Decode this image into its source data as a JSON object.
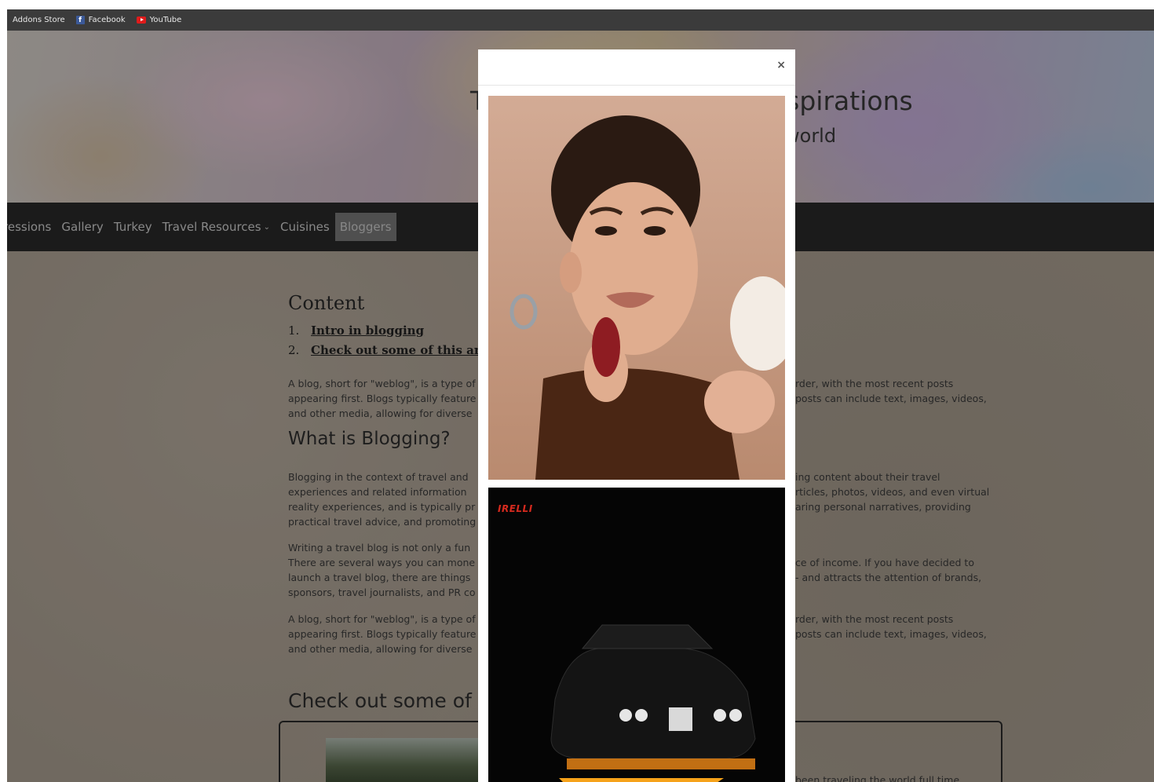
{
  "bookmarks": [
    {
      "label": "Addons Store"
    },
    {
      "label": "Facebook",
      "icon": "facebook-icon"
    },
    {
      "label": "YouTube",
      "icon": "youtube-icon"
    }
  ],
  "hero": {
    "title_partial_left": "T",
    "title_partial_right": "spirations",
    "subtitle_partial": "world"
  },
  "nav": {
    "items": [
      "ressions",
      "Gallery",
      "Turkey",
      "Travel Resources",
      "Cuisines"
    ],
    "active": "Bloggers"
  },
  "content": {
    "heading": "Content",
    "toc": [
      {
        "num": "1.",
        "label": "Intro in blogging"
      },
      {
        "num": "2.",
        "label": "Check out some of this ama:"
      }
    ],
    "p1_left": [
      "A blog, short for \"weblog\", is a type of",
      "appearing first. Blogs typically feature",
      "and other media, allowing for diverse"
    ],
    "p1_right": [
      "rder, with the most recent posts",
      "posts can include text, images, videos,"
    ],
    "h_blogging": "What is Blogging?",
    "p2_left": [
      "Blogging in the context of travel and",
      "experiences and related information",
      "reality experiences, and is typically pr",
      "practical travel advice, and promoting"
    ],
    "p2_right": [
      "ing content about their travel",
      "rticles, photos, videos, and even virtual",
      "aring personal narratives, providing"
    ],
    "p3_left": [
      "Writing a travel blog is not only a fun",
      "There are several ways you can mone",
      "launch a travel blog, there are things",
      "sponsors, travel journalists, and PR co"
    ],
    "p3_right": [
      "ce of income. If you have decided to",
      "- and attracts the attention of brands,"
    ],
    "p4_left": [
      "A blog, short for \"weblog\", is a type of",
      "appearing first. Blogs typically feature",
      "and other media, allowing for diverse"
    ],
    "p4_right": [
      "rder, with the most recent posts",
      "posts can include text, images, videos,"
    ],
    "h_checkout": "Check out some of",
    "card_text_right": "been traveling the world full time"
  },
  "modal": {
    "close_label": "×",
    "photo2_brand": "IRELLI"
  },
  "colors": {
    "modal_bg": "#ffffff",
    "nav_bg": "#2a2a2a",
    "active_nav": "#7a7a7a"
  }
}
